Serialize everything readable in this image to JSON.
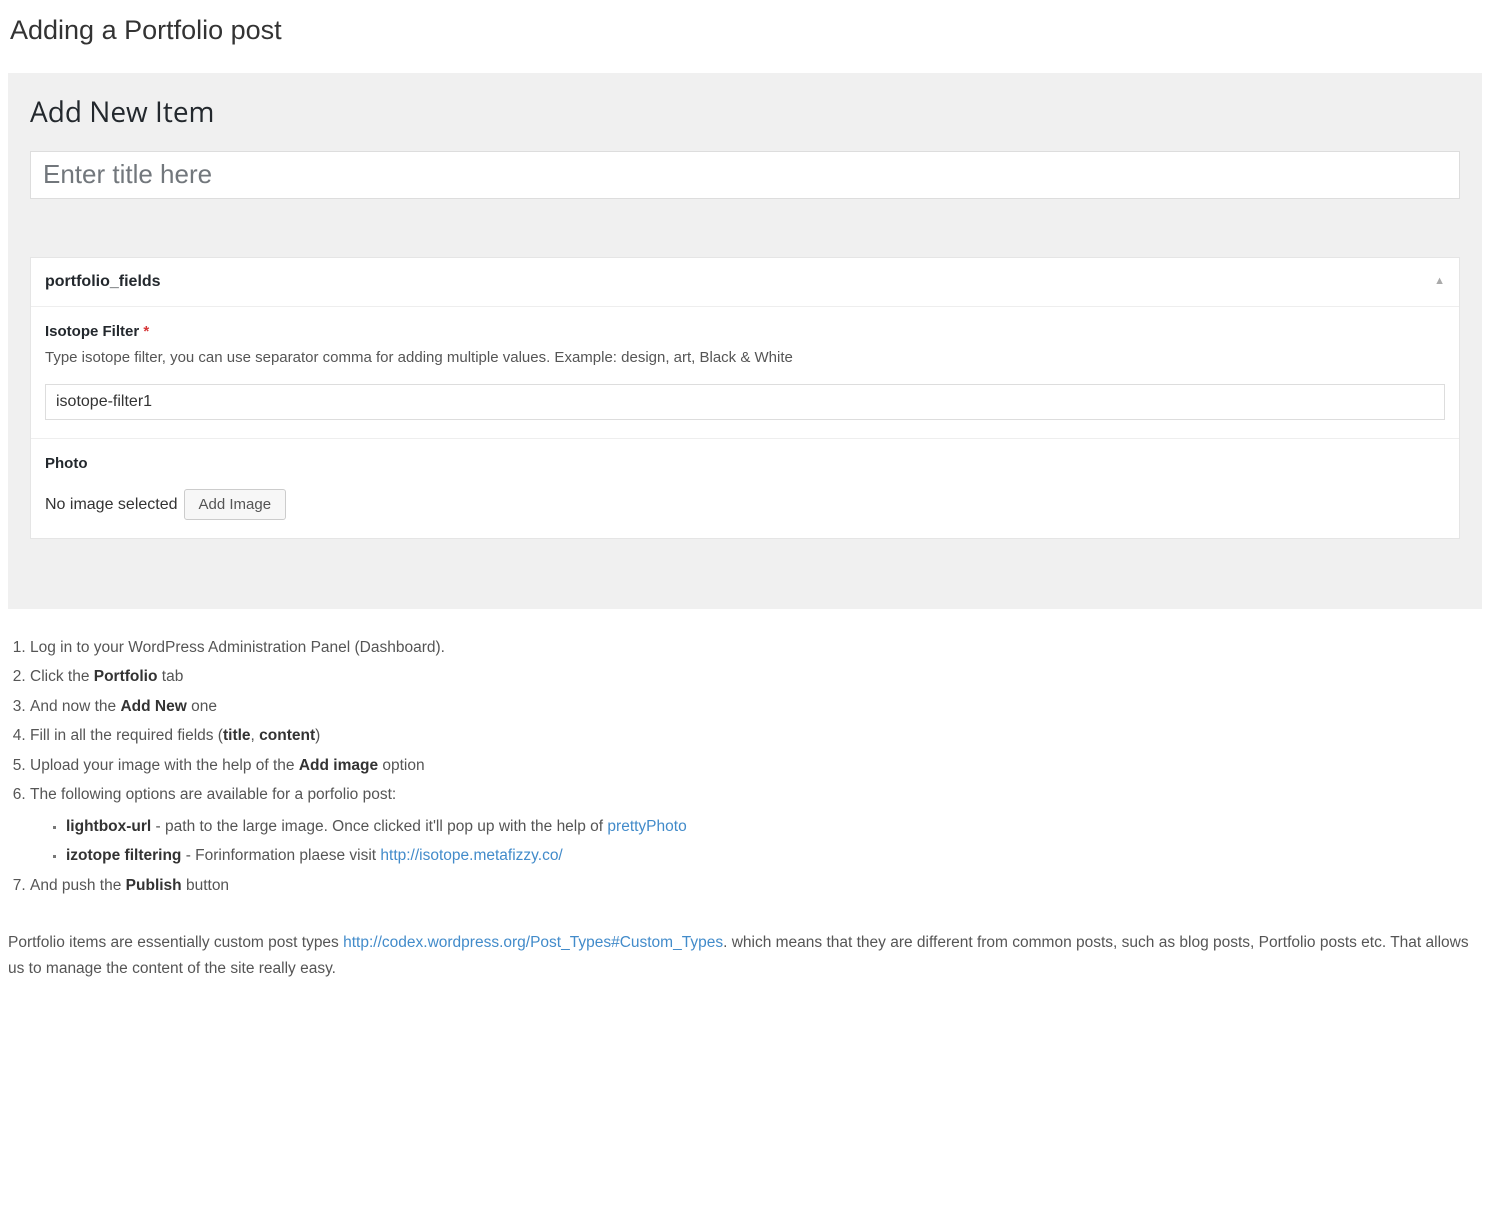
{
  "page": {
    "title": "Adding a Portfolio post"
  },
  "admin": {
    "heading": "Add New Item",
    "title_placeholder": "Enter title here",
    "metabox": {
      "title": "portfolio_fields",
      "collapse_glyph": "▲"
    },
    "isotope": {
      "label": "Isotope Filter",
      "required_mark": "*",
      "help": "Type isotope filter, you can use separator comma for adding multiple values. Example: design, art, Black & White",
      "value": "isotope-filter1"
    },
    "photo": {
      "label": "Photo",
      "no_image_text": "No image selected",
      "button_label": "Add Image"
    }
  },
  "steps": {
    "s1": "Log in to your WordPress Administration Panel (Dashboard).",
    "s2_a": "Click the ",
    "s2_b": "Portfolio",
    "s2_c": " tab",
    "s3_a": "And now the ",
    "s3_b": "Add New",
    "s3_c": " one",
    "s4_a": "Fill in all the required fields (",
    "s4_b": "title",
    "s4_c": ", ",
    "s4_d": "content",
    "s4_e": ")",
    "s5_a": "Upload your image with the help of the ",
    "s5_b": "Add image",
    "s5_c": " option",
    "s6": "The following options are available for a porfolio post:",
    "sub1_a": "lightbox-url",
    "sub1_b": " - path to the large image. Once clicked it'll pop up with the help of ",
    "sub1_link": "prettyPhoto",
    "sub2_a": "izotope filtering",
    "sub2_b": " - Forinformation plaese visit ",
    "sub2_link": "http://isotope.metafizzy.co/",
    "s7_a": "And push the ",
    "s7_b": "Publish",
    "s7_c": " button"
  },
  "closing": {
    "a": "Portfolio items are essentially custom post types ",
    "link": "http://codex.wordpress.org/Post_Types#Custom_Types",
    "b": ". which means that they are different from common posts, such as blog posts, Portfolio posts etc. That allows us to manage the content of the site really easy."
  }
}
